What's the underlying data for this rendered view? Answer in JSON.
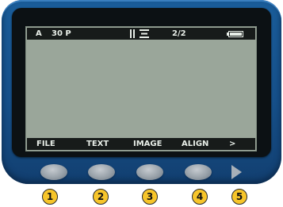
{
  "status_bar": {
    "mode": "A",
    "font_size": "30 P",
    "align_icon": "justify-align-icon",
    "page": "2/2",
    "battery_icon": "battery-icon"
  },
  "softkeys": [
    "FILE",
    "TEXT",
    "IMAGE",
    "ALIGN",
    ">"
  ],
  "hardware_buttons": {
    "icons": [
      "oval-button-1",
      "oval-button-2",
      "oval-button-3",
      "oval-button-4",
      "arrow-right-button"
    ]
  },
  "callouts": [
    "1",
    "2",
    "3",
    "4",
    "5"
  ],
  "colors": {
    "bezel": "#16508a",
    "lcd": "#9aa69a",
    "bar": "#171b1a",
    "callout": "#f7c52a"
  }
}
